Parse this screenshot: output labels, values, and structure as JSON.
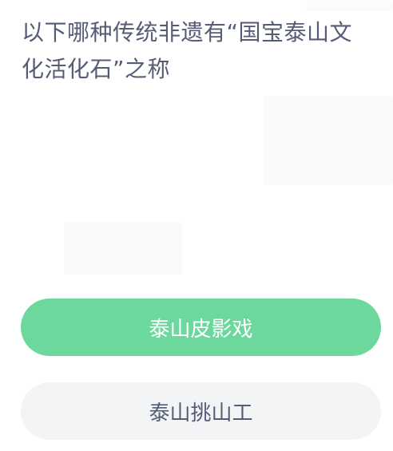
{
  "question": {
    "text": "以下哪种传统非遗有“国宝泰山文化活化石”之称"
  },
  "options": [
    {
      "label": "泰山皮影戏",
      "state": "selected",
      "color": "#6dd89e"
    },
    {
      "label": "泰山挑山工",
      "state": "default",
      "color": "#f3f4f6"
    }
  ],
  "colors": {
    "question_text": "#545d75",
    "selected_text": "#ffffff",
    "default_text": "#545d75",
    "background": "#ffffff"
  }
}
